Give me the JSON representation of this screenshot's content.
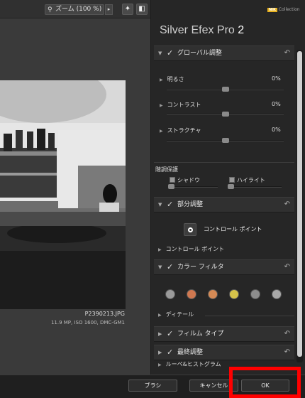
{
  "toolbar": {
    "zoom_label": "ズーム (100 %)",
    "zoom_arrow": "▸",
    "light_icon": "lightbulb-icon",
    "compare_icon": "split-view-icon"
  },
  "image": {
    "filename": "P2390213.JPG",
    "info": "11.9 MP, ISO 1600, DMC-GM1"
  },
  "panel": {
    "brand_badge": "NIK",
    "brand_label": "Collection",
    "app_title": "Silver Efex Pro",
    "app_version": "2",
    "global": {
      "label": "グローバル調整",
      "brightness": {
        "label": "明るさ",
        "value": "0%",
        "level": 0.5
      },
      "contrast": {
        "label": "コントラスト",
        "value": "0%",
        "level": 0.5
      },
      "structure": {
        "label": "ストラクチャ",
        "value": "0%",
        "level": 0.5
      },
      "tone_protection": "階調保護",
      "shadows": "シャドウ",
      "highlights": "ハイライト"
    },
    "selective": {
      "label": "部分調整",
      "control_point_button": "コントロール ポイント",
      "control_point_list": "コントロール ポイント"
    },
    "color_filter": {
      "label": "カラー フィルタ",
      "swatches": [
        "#9a9a9a",
        "#d07850",
        "#d58a55",
        "#d6c34a",
        "#8c8c8c",
        "#a8a8a8"
      ],
      "details": "ディテール"
    },
    "film_type": {
      "label": "フィルム タイプ"
    },
    "finishing": {
      "label": "最終調整"
    },
    "loupe": {
      "label": "ルーペ&ヒストグラム"
    }
  },
  "bottom": {
    "brush_label": "ブラシ",
    "cancel_label": "キャンセル",
    "ok_label": "OK",
    "highlight_color": "#ff0000"
  }
}
